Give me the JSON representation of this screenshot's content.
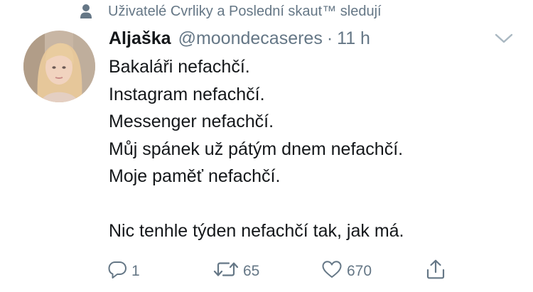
{
  "social_context": {
    "text": "Uživatelé Cvrliky a Poslední skaut™ sledují",
    "icon": "person-icon"
  },
  "tweet": {
    "author": {
      "name": "Aljaška",
      "handle": "@moondecaseres"
    },
    "separator": "·",
    "time": "11 h",
    "lines": [
      "Bakaláři nefachčí.",
      "Instagram nefachčí.",
      "Messenger nefachčí.",
      "Můj spánek už pátým dnem nefachčí.",
      "Moje paměť nefachčí.",
      "",
      "Nic tenhle týden nefachčí tak, jak má."
    ],
    "actions": {
      "reply": {
        "count": "1",
        "icon": "reply-icon"
      },
      "retweet": {
        "count": "65",
        "icon": "retweet-icon"
      },
      "like": {
        "count": "670",
        "icon": "heart-icon"
      },
      "share": {
        "icon": "share-icon"
      }
    },
    "menu_icon": "chevron-down-icon"
  },
  "colors": {
    "text_primary": "#14171a",
    "text_secondary": "#657786",
    "background": "#ffffff"
  }
}
